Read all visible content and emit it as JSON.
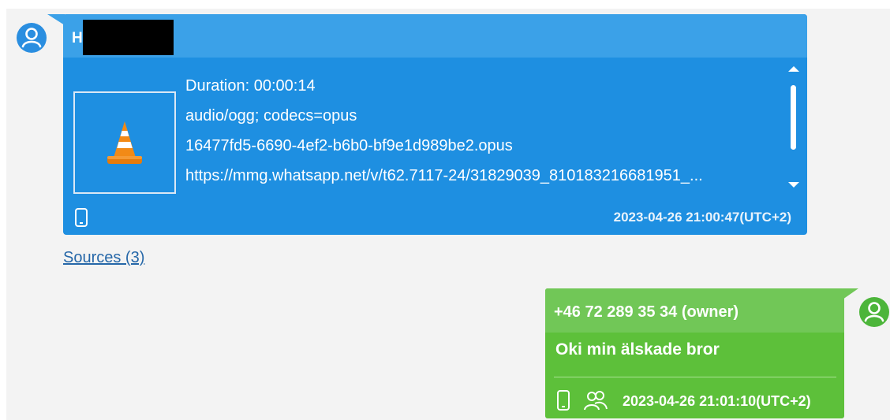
{
  "incoming_message": {
    "sender_name": "H",
    "media": {
      "duration": "Duration: 00:00:14",
      "mime_type": "audio/ogg; codecs=opus",
      "filename": "16477fd5-6690-4ef2-b6b0-bf9e1d989be2.opus",
      "url": "https://mmg.whatsapp.net/v/t62.7117-24/31829039_810183216681951_...",
      "thumbnail_icon": "vlc-cone-icon"
    },
    "source_icon": "phone-icon",
    "timestamp": "2023-04-26 21:00:47(UTC+2)"
  },
  "sources_link": "Sources (3)",
  "outgoing_message": {
    "sender": "+46 72 289 35 34 (owner)",
    "text": "Oki min älskade bror",
    "source_icon": "phone-icon",
    "group_icon": "contacts-icon",
    "timestamp": "2023-04-26 21:01:10(UTC+2)"
  },
  "colors": {
    "incoming_bubble": "#1e8fe1",
    "incoming_header": "#3ba1e8",
    "outgoing_bubble": "#5dc03a",
    "outgoing_header": "#71c757",
    "avatar_blue": "#2a8ee0",
    "avatar_green": "#4cb53a",
    "link": "#2567a8"
  }
}
